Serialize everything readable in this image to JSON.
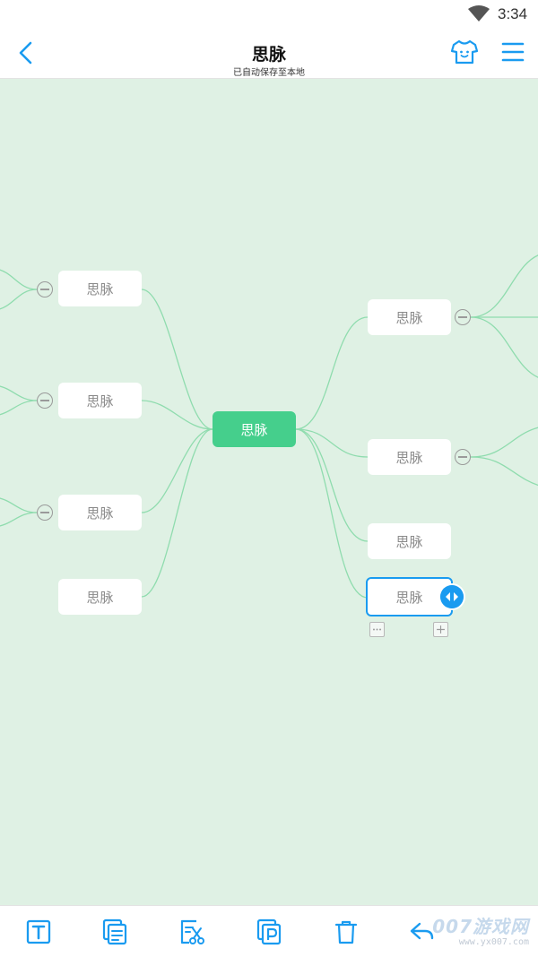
{
  "status_bar": {
    "time": "3:34",
    "wifi_icon": "wifi-icon"
  },
  "header": {
    "title": "思脉",
    "subtitle": "已自动保存至本地",
    "back_icon": "back-chevron-icon",
    "theme_icon": "shirt-icon",
    "menu_icon": "menu-icon"
  },
  "mindmap": {
    "center": {
      "label": "思脉"
    },
    "left_nodes": [
      {
        "label": "思脉",
        "collapsible": true
      },
      {
        "label": "思脉",
        "collapsible": true
      },
      {
        "label": "思脉",
        "collapsible": true
      },
      {
        "label": "思脉",
        "collapsible": false
      }
    ],
    "right_nodes": [
      {
        "label": "思脉",
        "collapsible": true
      },
      {
        "label": "思脉",
        "collapsible": true
      },
      {
        "label": "思脉",
        "collapsible": false
      },
      {
        "label": "思脉",
        "collapsible": false,
        "selected": true
      }
    ],
    "colors": {
      "canvas": "#dff1e4",
      "center": "#45cf8c",
      "link": "#8fdcae",
      "selection": "#1a9bf0"
    }
  },
  "toolbar": {
    "items": [
      {
        "icon": "text-icon"
      },
      {
        "icon": "copy-icon"
      },
      {
        "icon": "cut-icon"
      },
      {
        "icon": "paste-icon"
      },
      {
        "icon": "delete-icon"
      },
      {
        "icon": "undo-icon"
      }
    ],
    "accent": "#1a9bf0"
  },
  "watermark": {
    "big": "007游戏网",
    "small": "www.yx007.com"
  }
}
